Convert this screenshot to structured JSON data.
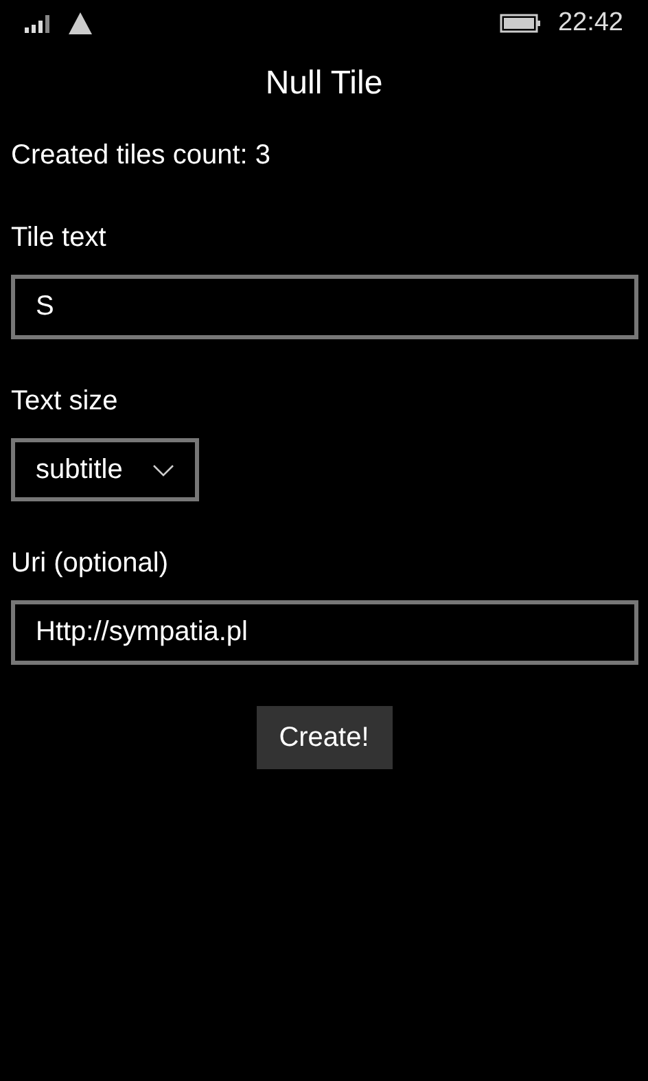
{
  "status_bar": {
    "time": "22:42"
  },
  "title": "Null Tile",
  "count_text": "Created tiles count: 3",
  "fields": [
    {
      "kind": "text",
      "label": "Tile text",
      "value": "S"
    },
    {
      "kind": "dropdown",
      "label": "Text size",
      "value": "subtitle"
    },
    {
      "kind": "text",
      "label": "Uri (optional)",
      "value": "Http://sympatia.pl"
    }
  ],
  "button": "Create!"
}
